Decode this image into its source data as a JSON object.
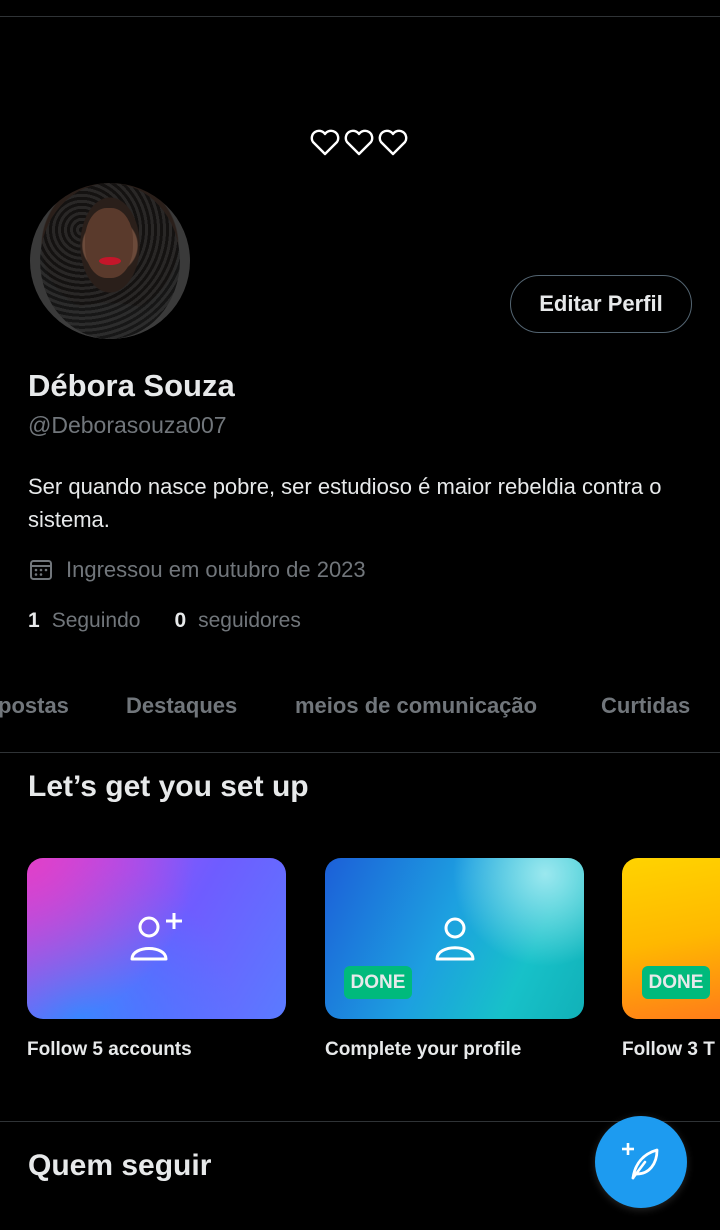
{
  "profile": {
    "banner_hearts": "♡♡♡",
    "edit_button_label": "Editar Perfil",
    "name": "Débora Souza",
    "handle": "@Deborasouza007",
    "bio": "Ser quando nasce pobre, ser estudioso é maior rebeldia contra o sistema.",
    "joined": "Ingressou em outubro de 2023",
    "following_count": "1",
    "following_label": "Seguindo",
    "followers_count": "0",
    "followers_label": "seguidores"
  },
  "tabs": [
    {
      "label": "postas"
    },
    {
      "label": "Destaques"
    },
    {
      "label": "meios de comunicação"
    },
    {
      "label": "Curtidas"
    }
  ],
  "setup": {
    "title": "Let’s get you set up",
    "cards": [
      {
        "label": "Follow 5 accounts",
        "icon": "add-person-icon",
        "done": false
      },
      {
        "label": "Complete your profile",
        "icon": "person-icon",
        "done": true,
        "done_label": "DONE"
      },
      {
        "label": "Follow 3 T",
        "done": true,
        "done_label": "DONE"
      }
    ]
  },
  "who_to_follow": {
    "title": "Quem seguir"
  },
  "colors": {
    "background": "#000000",
    "accent": "#1d9bf0",
    "done_badge": "#00ba7c",
    "muted_text": "#71767b"
  }
}
